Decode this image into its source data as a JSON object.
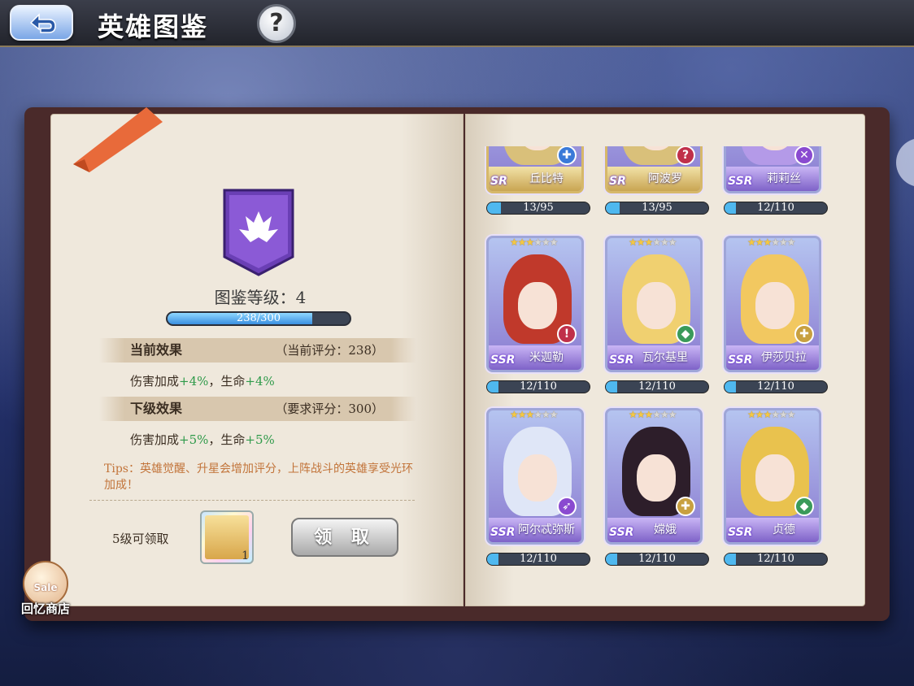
{
  "header": {
    "title": "英雄图鉴",
    "help_label": "?"
  },
  "collection": {
    "level_label": "图鉴等级：4",
    "progress_text": "238/300",
    "progress_fraction": 0.793,
    "current": {
      "label": "当前效果",
      "score_text": "（当前评分：238）",
      "effect_prefix": "伤害加成",
      "effect_dmg": "+4%",
      "effect_mid": "，生命",
      "effect_hp": "+4%"
    },
    "next": {
      "label": "下级效果",
      "score_text": "（要求评分：300）",
      "effect_prefix": "伤害加成",
      "effect_dmg": "+5%",
      "effect_mid": "，生命",
      "effect_hp": "+5%"
    },
    "tips": "Tips：英雄觉醒、升星会增加评分，上阵战斗的英雄享受光环加成！",
    "reward_label": "5级可领取",
    "reward_count": "1",
    "claim_label": "领 取"
  },
  "shop": {
    "sale": "Sale",
    "label": "回忆商店"
  },
  "heroes": [
    {
      "name": "丘比特",
      "rarity": "SR",
      "progress": "13/95",
      "fraction": 0.137,
      "stars": 0,
      "class_icon": "cross-icon",
      "color": "#d9c07a"
    },
    {
      "name": "阿波罗",
      "rarity": "SR",
      "progress": "13/95",
      "fraction": 0.137,
      "stars": 0,
      "class_icon": "question-icon",
      "color": "#d9c07a"
    },
    {
      "name": "莉莉丝",
      "rarity": "SSR",
      "progress": "12/110",
      "fraction": 0.109,
      "stars": 0,
      "class_icon": "swords-icon",
      "color": "#b49ae8"
    },
    {
      "name": "米迦勒",
      "rarity": "SSR",
      "progress": "12/110",
      "fraction": 0.109,
      "stars": 3,
      "class_icon": "alert-icon",
      "color": "#c0392b"
    },
    {
      "name": "瓦尔基里",
      "rarity": "SSR",
      "progress": "12/110",
      "fraction": 0.109,
      "stars": 3,
      "class_icon": "shield-icon",
      "color": "#f0d070"
    },
    {
      "name": "伊莎贝拉",
      "rarity": "SSR",
      "progress": "12/110",
      "fraction": 0.109,
      "stars": 3,
      "class_icon": "plus-icon",
      "color": "#f2c860"
    },
    {
      "name": "阿尔忒弥斯",
      "rarity": "SSR",
      "progress": "12/110",
      "fraction": 0.109,
      "stars": 3,
      "class_icon": "bow-icon",
      "color": "#dfe6f7"
    },
    {
      "name": "嫦娥",
      "rarity": "SSR",
      "progress": "12/110",
      "fraction": 0.109,
      "stars": 3,
      "class_icon": "plus-icon",
      "color": "#2d1e2a"
    },
    {
      "name": "贞德",
      "rarity": "SSR",
      "progress": "12/110",
      "fraction": 0.109,
      "stars": 3,
      "class_icon": "shield-icon",
      "color": "#e9c24e"
    }
  ]
}
